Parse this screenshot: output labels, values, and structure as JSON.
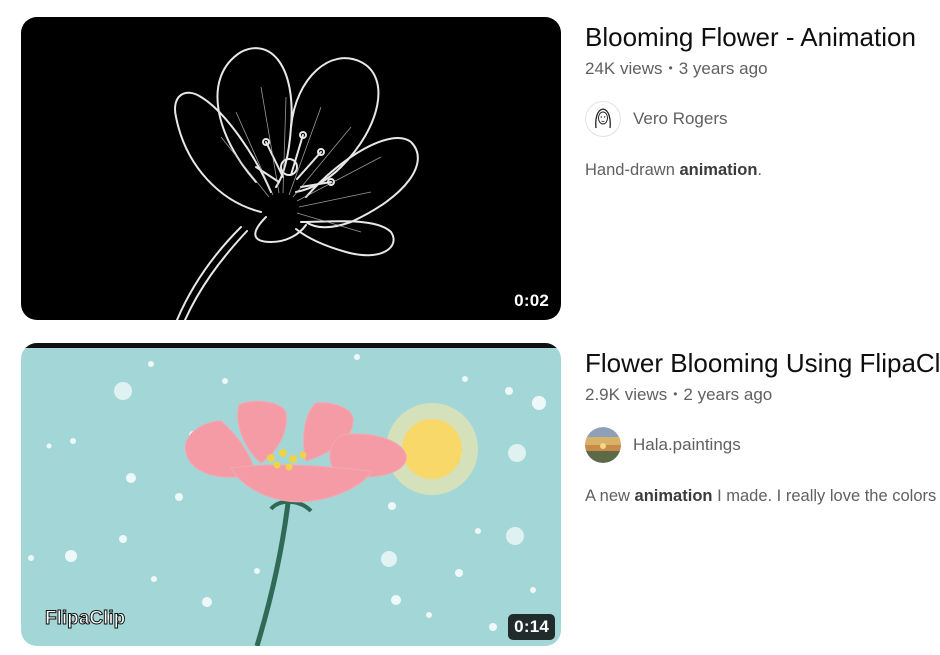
{
  "results": [
    {
      "title": "Blooming Flower - Animation",
      "views": "24K views",
      "age": "3 years ago",
      "channel": "Vero Rogers",
      "duration": "0:02",
      "desc_pre": "Hand-drawn ",
      "desc_bold": "animation",
      "desc_post": ".",
      "desc_bold2": "",
      "desc_post2": ""
    },
    {
      "title": "Flower Blooming Using FlipaClip",
      "views": "2.9K views",
      "age": "2 years ago",
      "channel": "Hala.paintings",
      "duration": "0:14",
      "desc_pre": "A new ",
      "desc_bold": "animation",
      "desc_post": " I made. I really love the colors",
      "watermark": "FlipaClip"
    }
  ],
  "separator": "•",
  "colors": {
    "thumb1_bg": "#000000",
    "thumb2_bg": "#a3d6d6",
    "petal_pink": "#f49ba6",
    "sun": "#f9d86a",
    "stem": "#2f6a57"
  },
  "icons": [
    "avatar-vero-rogers",
    "avatar-hala-paintings"
  ]
}
